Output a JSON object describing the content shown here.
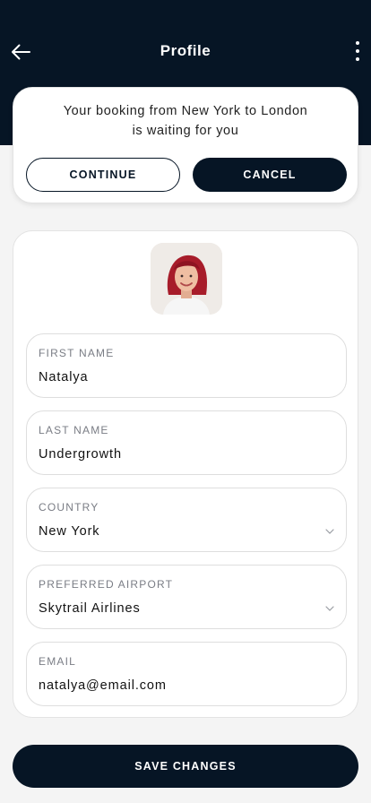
{
  "header": {
    "title": "Profile",
    "back_icon": "arrow-left-icon",
    "more_icon": "more-vertical-icon"
  },
  "notice": {
    "line1": "Your booking from New York to London",
    "line2": "is waiting for you",
    "continue_label": "CONTINUE",
    "cancel_label": "CANCEL"
  },
  "profile": {
    "avatar_icon": "user-photo",
    "fields": [
      {
        "label": "FIRST NAME",
        "value": "Natalya"
      },
      {
        "label": "LAST NAME",
        "value": "Undergrowth"
      },
      {
        "label": "COUNTRY",
        "value": "New York",
        "icon": "chevron-down-icon"
      },
      {
        "label": "PREFERRED AIRPORT",
        "value": "Skytrail Airlines",
        "icon": "chevron-down-icon"
      },
      {
        "label": "EMAIL",
        "value": "natalya@email.com"
      }
    ]
  },
  "save_label": "SAVE CHANGES",
  "colors": {
    "primary": "#061525",
    "background": "#f4f4f4",
    "card": "#ffffff"
  }
}
